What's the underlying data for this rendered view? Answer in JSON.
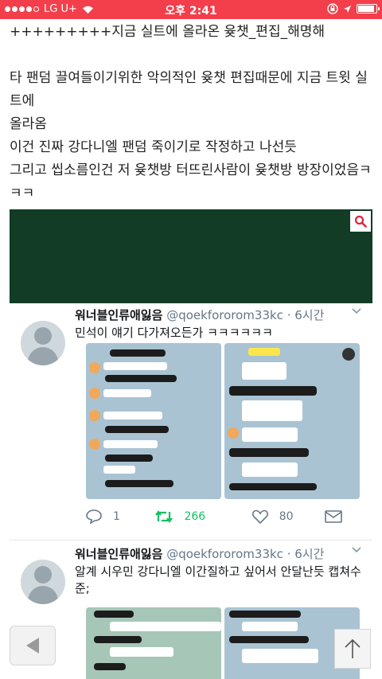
{
  "status": {
    "carrier": "LG U+",
    "time": "오후 2:41"
  },
  "article": {
    "line1": "+++++++++지금 실트에 올라온 윶챗_편집_해명해",
    "line2": "타 팬덤 끌여들이기위한 악의적인 윶챗 편집때문에 지금 트윗 실트에",
    "line3": "올라옴",
    "line4": "이건 진짜 강다니엘 팬덤 죽이기로 작정하고 나선듯",
    "line5": "그리고 씹소름인건 저 윶챗방 터뜨린사람이 윶챗방 방장이었음ㅋㅋㅋ",
    "line6": "ㅋ"
  },
  "tweets": [
    {
      "name": "워너블인류애잃음",
      "handle": "@qoekfororom33kc",
      "time": "· 6시간",
      "text": "민석이 얘기 다가져오든가 ㅋㅋㅋㅋㅋㅋ",
      "replies": "1",
      "retweets": "266",
      "likes": "80"
    },
    {
      "name": "워너블인류애잃음",
      "handle": "@qoekfororom33kc",
      "time": "· 6시간",
      "text": "알계 시우민 강다니엘 이간질하고 싶어서 안달난듯 캡쳐수준;"
    }
  ],
  "colors": {
    "status_bar": "#f23f4b",
    "embed_header": "#123c25",
    "retweet_green": "#17bf63",
    "search_red": "#e0263a"
  },
  "icons": [
    "search-icon",
    "reply-icon",
    "retweet-icon",
    "like-icon",
    "dm-icon",
    "back-arrow-icon",
    "scroll-top-icon"
  ]
}
